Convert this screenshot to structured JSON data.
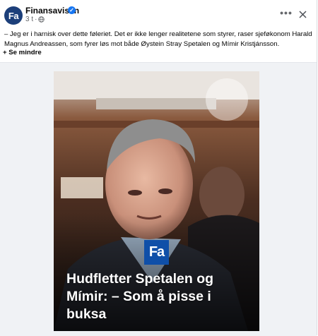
{
  "post": {
    "page_name": "Finansavisen",
    "avatar_text": "Fa",
    "time": "3 t",
    "caption": "– Jeg er i harnisk over dette føleriet. Det er ikke lenger realitetene som styrer, raser sjeføkonom Harald Magnus Andreassen, som fyrer løs mot både Øystein Stray Spetalen og Mímir Kristjánsson.",
    "see_less": "+ Se mindre",
    "more_label": "•••"
  },
  "media": {
    "logo_text": "Fa",
    "headline": "Hudfletter Spetalen og Mímir: – Som å pisse i buksa"
  },
  "colors": {
    "brand": "#1c3f7a",
    "logo_badge": "#0f4fa8",
    "verified": "#1877f2"
  },
  "icons": [
    "verified-icon",
    "globe-icon",
    "more-icon",
    "close-icon"
  ]
}
